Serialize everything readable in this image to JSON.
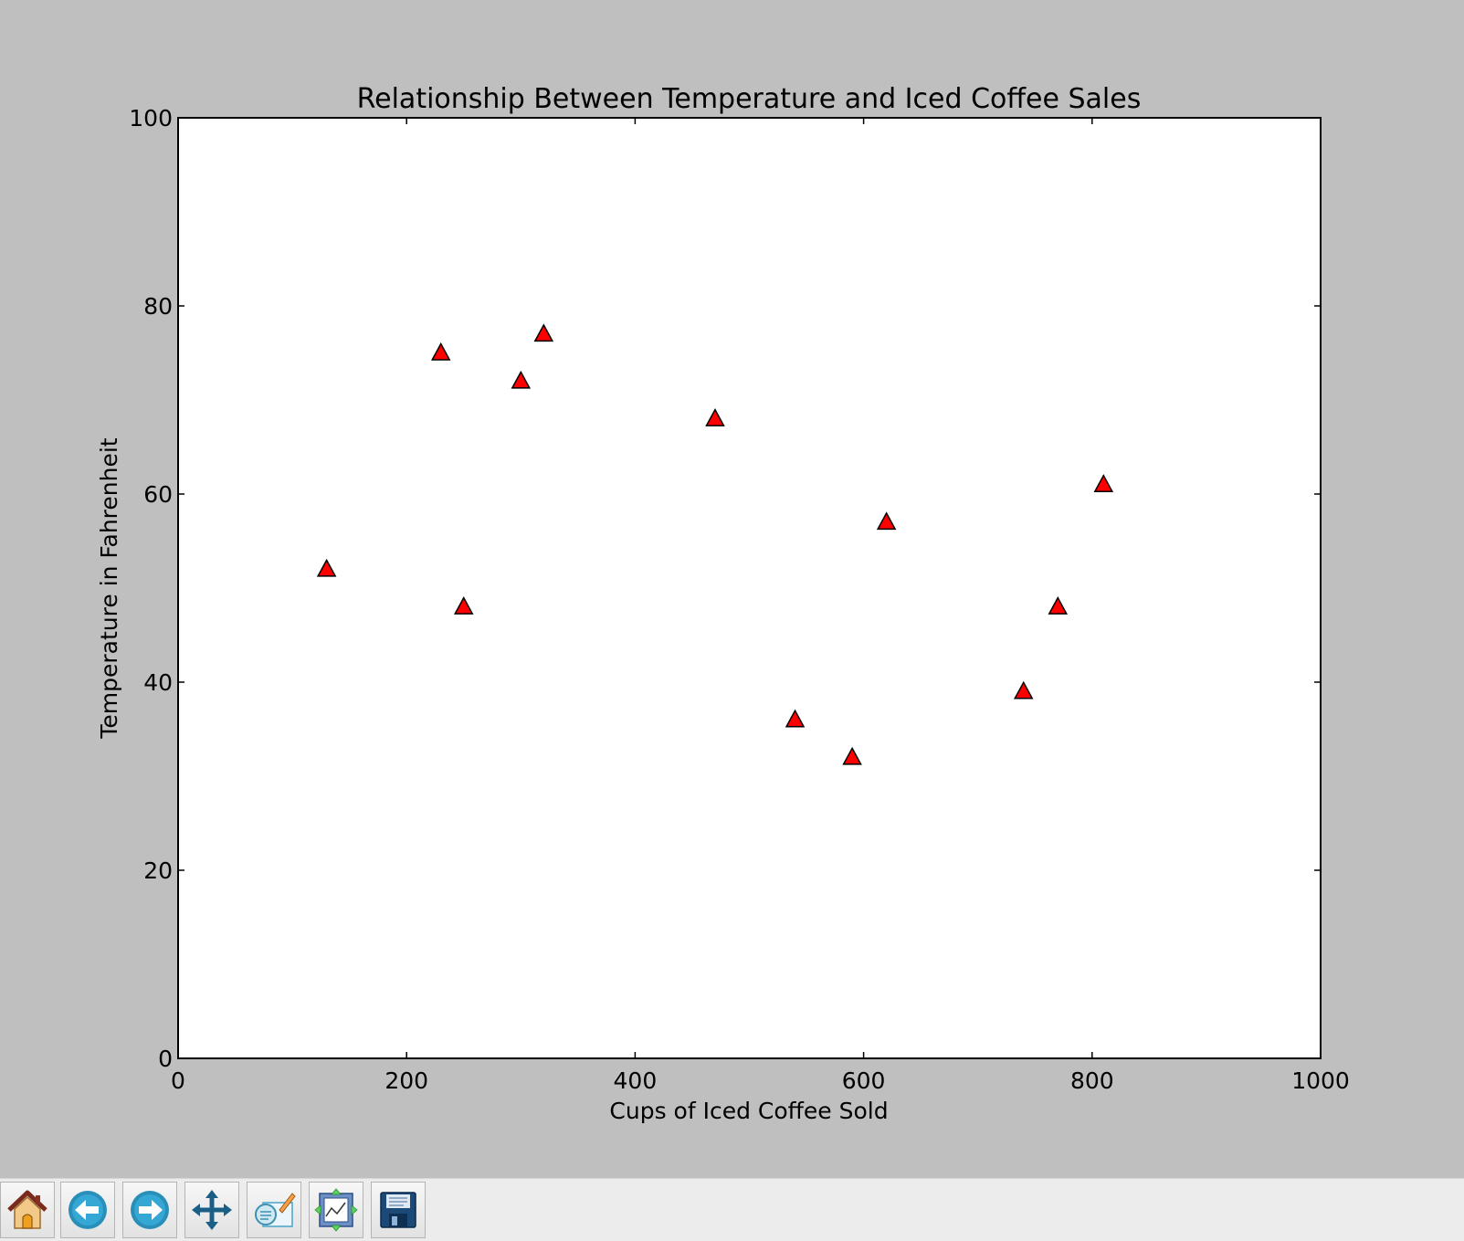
{
  "chart_data": {
    "type": "scatter",
    "title": "Relationship Between Temperature and Iced Coffee Sales",
    "xlabel": "Cups of Iced Coffee Sold",
    "ylabel": "Temperature in Fahrenheit",
    "xlim": [
      0,
      1000
    ],
    "ylim": [
      0,
      100
    ],
    "xticks": [
      0,
      200,
      400,
      600,
      800,
      1000
    ],
    "yticks": [
      0,
      20,
      40,
      60,
      80,
      100
    ],
    "marker": "triangle-up",
    "marker_color": "#ff0000",
    "marker_edge_color": "#000000",
    "grid": false,
    "points": [
      {
        "x": 130,
        "y": 52
      },
      {
        "x": 230,
        "y": 75
      },
      {
        "x": 250,
        "y": 48
      },
      {
        "x": 300,
        "y": 72
      },
      {
        "x": 320,
        "y": 77
      },
      {
        "x": 470,
        "y": 68
      },
      {
        "x": 540,
        "y": 36
      },
      {
        "x": 590,
        "y": 32
      },
      {
        "x": 620,
        "y": 57
      },
      {
        "x": 740,
        "y": 39
      },
      {
        "x": 770,
        "y": 48
      },
      {
        "x": 810,
        "y": 61
      }
    ]
  },
  "toolbar": {
    "buttons": [
      {
        "name": "home-button",
        "icon": "home-icon"
      },
      {
        "name": "back-button",
        "icon": "back-arrow-icon"
      },
      {
        "name": "forward-button",
        "icon": "forward-arrow-icon"
      },
      {
        "name": "pan-button",
        "icon": "move-icon"
      },
      {
        "name": "zoom-button",
        "icon": "zoom-rect-icon"
      },
      {
        "name": "subplots-button",
        "icon": "subplots-icon"
      },
      {
        "name": "save-button",
        "icon": "floppy-disk-icon"
      }
    ]
  }
}
